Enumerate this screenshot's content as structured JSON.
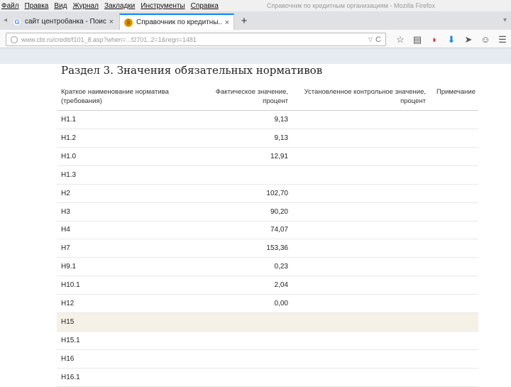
{
  "menu": {
    "items": [
      "Файл",
      "Правка",
      "Вид",
      "Журнал",
      "Закладки",
      "Инструменты",
      "Справка"
    ],
    "window_title": "Справочник по кредитным организациям - Mozilla Firefox"
  },
  "tabs": [
    {
      "title": "сайт центробанка - Поиск...",
      "favicon": "google-icon",
      "close": "×"
    },
    {
      "title": "Справочник по кредитны...",
      "favicon": "cbr-icon",
      "close": "×"
    }
  ],
  "new_tab": "+",
  "url": "www.cbr.ru/credit/f101_8.asp?when=...f2701..2=1&regn=1481",
  "reload": "C",
  "page": {
    "heading": "Раздел 3. Значения обязательных нормативов",
    "columns": [
      "Краткое наименование норматива (требования)",
      "Фактическое значение, процент",
      "Установленное контрольное значение, процент",
      "Примечание"
    ],
    "rows": [
      {
        "name": "Н1.1",
        "value": "9,13"
      },
      {
        "name": "Н1.2",
        "value": "9,13"
      },
      {
        "name": "Н1.0",
        "value": "12,91"
      },
      {
        "name": "Н1.3",
        "value": ""
      },
      {
        "name": "Н2",
        "value": "102,70"
      },
      {
        "name": "Н3",
        "value": "90,20"
      },
      {
        "name": "Н4",
        "value": "74,07"
      },
      {
        "name": "Н7",
        "value": "153,36"
      },
      {
        "name": "Н9.1",
        "value": "0,23"
      },
      {
        "name": "Н10.1",
        "value": "2,04"
      },
      {
        "name": "Н12",
        "value": "0,00"
      },
      {
        "name": "Н15",
        "value": "",
        "highlight": true
      },
      {
        "name": "Н15.1",
        "value": ""
      },
      {
        "name": "Н16",
        "value": ""
      },
      {
        "name": "Н16.1",
        "value": ""
      }
    ]
  }
}
